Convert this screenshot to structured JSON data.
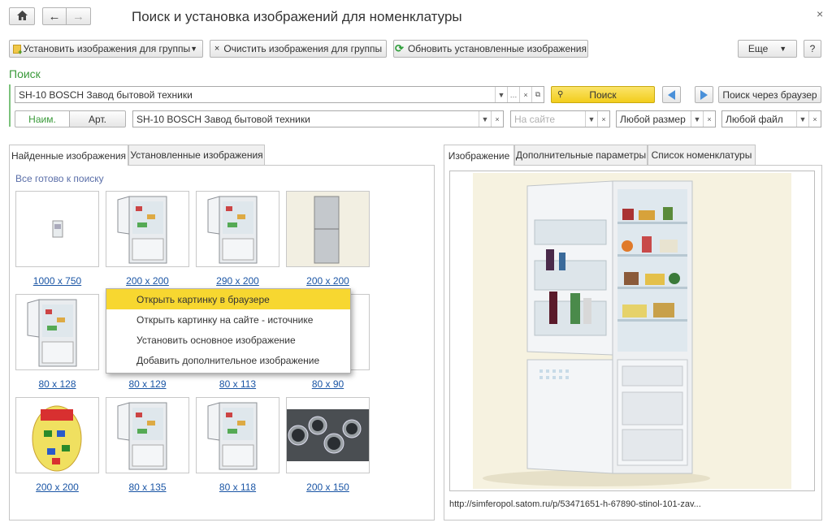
{
  "window": {
    "title": "Поиск и установка изображений для номенклатуры",
    "close": "×"
  },
  "nav": {
    "home": "⌂",
    "back": "←",
    "forward": "→"
  },
  "toolbar": {
    "set_group": "Установить изображения для группы",
    "clear_group": "Очистить изображения для группы",
    "refresh": "Обновить установленные изображения",
    "more": "Еще",
    "help": "?"
  },
  "search": {
    "section_label": "Поиск",
    "query": "SH-10 BOSCH Завод бытовой техники",
    "search_button": "Поиск",
    "browser_search": "Поиск через браузер"
  },
  "filters": {
    "toggle_name": "Наим.",
    "toggle_art": "Арт.",
    "name_value": "SH-10 BOSCH Завод бытовой техники",
    "site_placeholder": "На сайте",
    "size_value": "Любой размер",
    "file_value": "Любой файл"
  },
  "left_tabs": [
    "Найденные изображения",
    "Установленные изображения"
  ],
  "status": "Все готово к поиску",
  "thumbnails": [
    {
      "caption": "1000 x 750",
      "kind": "fridge-tiny"
    },
    {
      "caption": "200 x 200",
      "kind": "fridge-open"
    },
    {
      "caption": "290 x 200",
      "kind": "fridge-open"
    },
    {
      "caption": "200 x 200",
      "kind": "fridge-silver"
    },
    {
      "caption": "80 x 128",
      "kind": "fridge-open"
    },
    {
      "caption": "80 x 129",
      "kind": "fridge-open"
    },
    {
      "caption": "80 x 113",
      "kind": "fridge-open"
    },
    {
      "caption": "80 x 90",
      "kind": "fridge-open"
    },
    {
      "caption": "200 x 200",
      "kind": "toy-bag"
    },
    {
      "caption": "80 x 135",
      "kind": "fridge-open"
    },
    {
      "caption": "80 x 118",
      "kind": "fridge-open"
    },
    {
      "caption": "200 x 150",
      "kind": "pipes"
    }
  ],
  "context_menu": [
    "Открыть картинку в браузере",
    "Открыть картинку на сайте - источнике",
    "Установить основное изображение",
    "Добавить дополнительное изображение"
  ],
  "right_tabs": [
    "Изображение",
    "Дополнительные параметры",
    "Список номенклатуры"
  ],
  "preview_url": "http://simferopol.satom.ru/p/53471651-h-67890-stinol-101-zav..."
}
